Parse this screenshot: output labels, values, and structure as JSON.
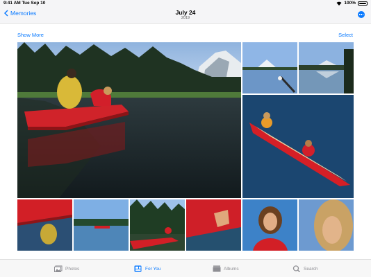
{
  "status_bar": {
    "time": "9:41 AM",
    "date": "Tue Sep 10",
    "battery": "100%"
  },
  "nav": {
    "back_label": "Memories",
    "title": "July 24",
    "subtitle": "2019",
    "more_icon": "ellipsis-circle-icon"
  },
  "actions": {
    "show_more": "Show More",
    "select": "Select"
  },
  "photos": [
    {
      "subject": "couple in red canoe on lake with mountain"
    },
    {
      "subject": "mountain over lake"
    },
    {
      "subject": "person standing on lakeshore"
    },
    {
      "subject": "person rowing red canoe"
    },
    {
      "subject": "canoe reflection close-up"
    },
    {
      "subject": "red canoe on distant lake"
    },
    {
      "subject": "red canoe by forest"
    },
    {
      "subject": "hand touching water from canoe"
    },
    {
      "subject": "portrait of smiling woman"
    },
    {
      "subject": "close-up portrait"
    }
  ],
  "tabs": [
    {
      "label": "Photos",
      "icon": "photos-icon",
      "active": false
    },
    {
      "label": "For You",
      "icon": "for-you-icon",
      "active": true
    },
    {
      "label": "Albums",
      "icon": "albums-icon",
      "active": false
    },
    {
      "label": "Search",
      "icon": "search-icon",
      "active": false
    }
  ],
  "colors": {
    "accent": "#0a7aff",
    "inactive": "#8e8e93"
  }
}
